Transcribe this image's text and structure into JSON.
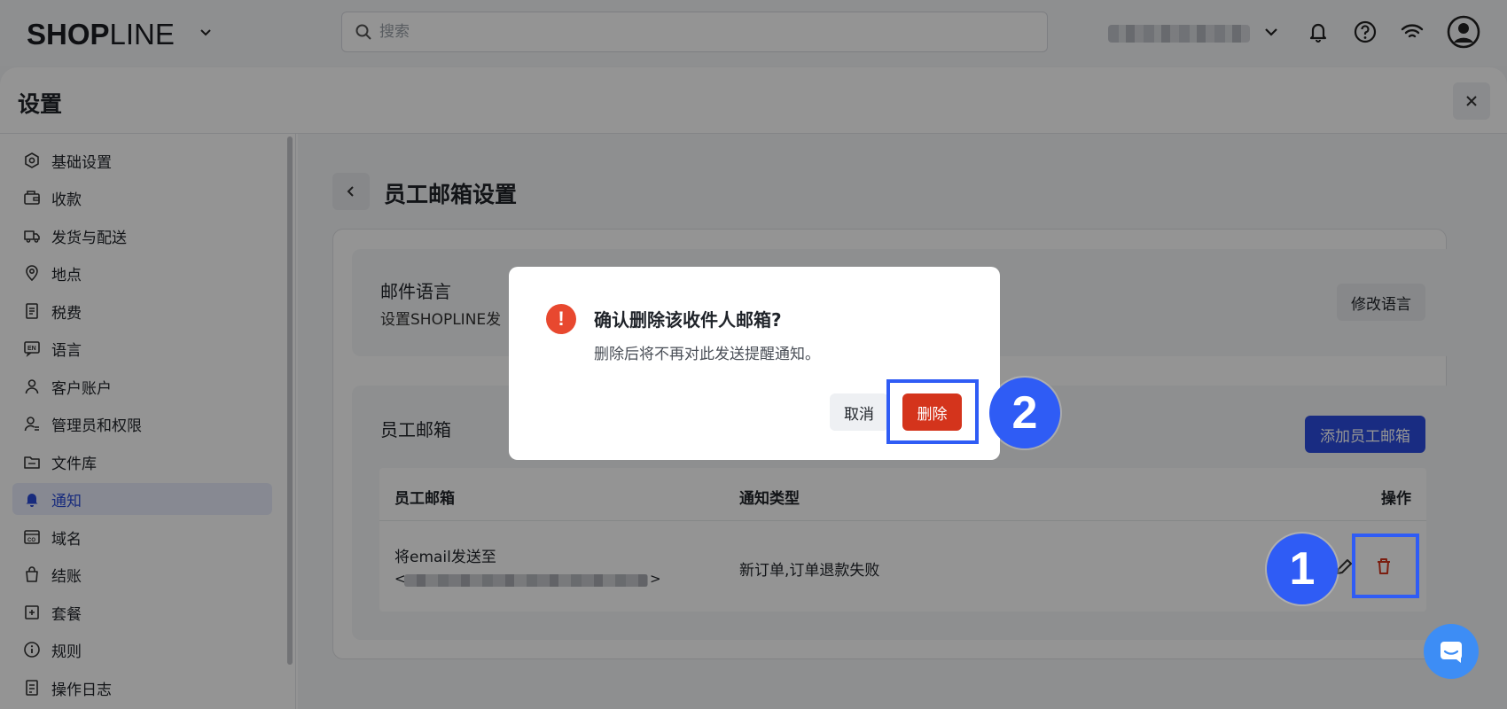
{
  "topbar": {
    "logo_bold_1": "SH",
    "logo_bold_2": "O",
    "logo_bold_3": "P",
    "logo_thin": "LINE",
    "search_placeholder": "搜索"
  },
  "panel": {
    "title": "设置"
  },
  "sidebar": {
    "items": [
      {
        "label": "基础设置",
        "icon": "settings-hex-icon"
      },
      {
        "label": "收款",
        "icon": "wallet-icon"
      },
      {
        "label": "发货与配送",
        "icon": "truck-icon"
      },
      {
        "label": "地点",
        "icon": "location-pin-icon"
      },
      {
        "label": "税费",
        "icon": "receipt-icon"
      },
      {
        "label": "语言",
        "icon": "language-icon"
      },
      {
        "label": "客户账户",
        "icon": "user-icon"
      },
      {
        "label": "管理员和权限",
        "icon": "admin-icon"
      },
      {
        "label": "文件库",
        "icon": "folder-icon"
      },
      {
        "label": "通知",
        "icon": "bell-icon"
      },
      {
        "label": "域名",
        "icon": "domain-icon"
      },
      {
        "label": "结账",
        "icon": "bag-icon"
      },
      {
        "label": "套餐",
        "icon": "plan-icon"
      },
      {
        "label": "规则",
        "icon": "info-icon"
      },
      {
        "label": "操作日志",
        "icon": "log-icon"
      }
    ],
    "active_index": 9
  },
  "page": {
    "title": "员工邮箱设置",
    "mail_language": {
      "title": "邮件语言",
      "desc": "设置SHOPLINE发",
      "button": "修改语言"
    },
    "staff_email": {
      "title": "员工邮箱",
      "add_button": "添加员工邮箱",
      "columns": [
        "员工邮箱",
        "通知类型",
        "操作"
      ],
      "rows": [
        {
          "email_prefix": "将email发送至",
          "email_open": "<",
          "email_close": ">",
          "types": "新订单,订单退款失败"
        }
      ]
    }
  },
  "dialog": {
    "title": "确认删除该收件人邮箱?",
    "desc": "删除后将不再对此发送提醒通知。",
    "cancel": "取消",
    "confirm": "删除",
    "icon_glyph": "!"
  },
  "annotations": {
    "step1": "1",
    "step2": "2",
    "color": "#2f5cf5"
  },
  "colors": {
    "primary": "#2c4de0",
    "danger": "#d4341c",
    "warning_icon": "#e8482f"
  }
}
